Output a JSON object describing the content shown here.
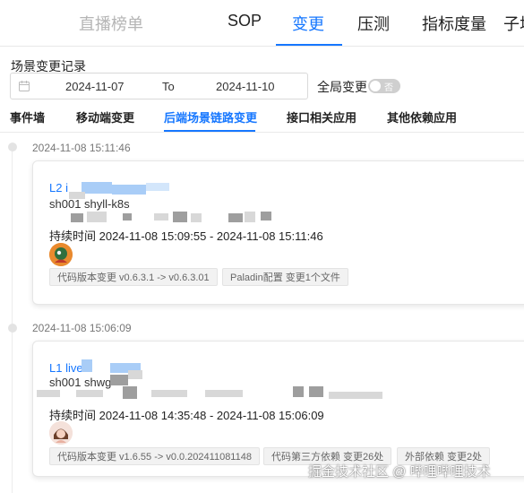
{
  "nav": {
    "items": [
      {
        "label": "直播榜单"
      },
      {
        "label": "SOP"
      },
      {
        "label": "变更"
      },
      {
        "label": "压测"
      },
      {
        "label": "指标度量"
      },
      {
        "label": "子场"
      }
    ]
  },
  "page": {
    "title": "场景变更记录"
  },
  "filters": {
    "start_date": "2024-11-07",
    "to_label": "To",
    "end_date": "2024-11-10",
    "global_change_label": "全局变更",
    "toggle_text": "否"
  },
  "subtabs": [
    {
      "label": "事件墙"
    },
    {
      "label": "移动端变更"
    },
    {
      "label": "后端场景链路变更"
    },
    {
      "label": "接口相关应用"
    },
    {
      "label": "其他依赖应用"
    }
  ],
  "records": [
    {
      "time": "2024-11-08 15:11:46",
      "title": "L2 i",
      "subtitle": "sh001 shyll-k8s",
      "duration": "持续时间 2024-11-08 15:09:55 - 2024-11-08 15:11:46",
      "tags": [
        "代码版本变更 v0.6.3.1 -> v0.6.3.01",
        "Paladin配置 变更1个文件"
      ]
    },
    {
      "time": "2024-11-08 15:06:09",
      "title": "L1 live",
      "subtitle": "sh001 shwg",
      "duration": "持续时间 2024-11-08 14:35:48 - 2024-11-08 15:06:09",
      "tags": [
        "代码版本变更 v1.6.55 -> v0.0.202411081148",
        "代码第三方依赖 变更26处",
        "外部依赖 变更2处"
      ]
    }
  ],
  "watermark": "掘金技术社区 @ 哔哩哔哩技术",
  "colors": {
    "accent": "#1677ff",
    "tag_bg": "#f2f2f2",
    "toggle_off": "#cfcfcf"
  }
}
